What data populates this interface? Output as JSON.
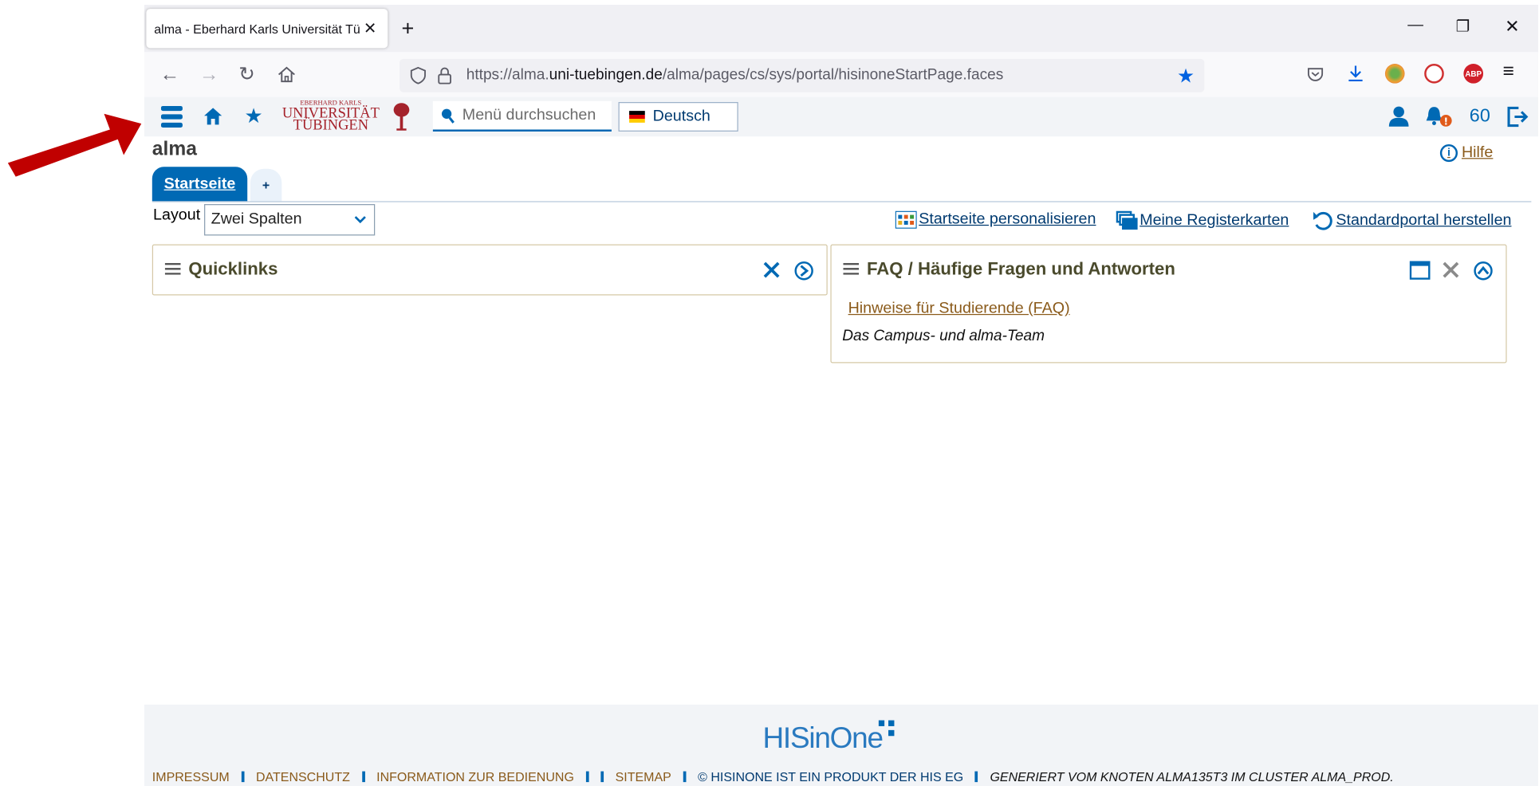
{
  "browser": {
    "tab_title": "alma - Eberhard Karls Universität Tü",
    "tab_close": "✕",
    "new_tab": "+",
    "url_prefix": "https://alma.",
    "url_domain": "uni-tuebingen.de",
    "url_path": "/alma/pages/cs/sys/portal/hisinoneStartPage.faces"
  },
  "header": {
    "search_placeholder": "Menü durchsuchen",
    "language": "Deutsch",
    "session_timer": "60",
    "logo_line1": "EBERHARD KARLS",
    "logo_line2": "UNIVERSITÄT",
    "logo_line3": "TÜBINGEN"
  },
  "page": {
    "title": "alma",
    "help_label": "Hilfe",
    "tabs": [
      {
        "label": "Startseite"
      }
    ],
    "add_tab": "+",
    "layout_label": "Layout",
    "layout_value": "Zwei Spalten",
    "actions": {
      "personalize": "Startseite personalisieren",
      "registers": "Meine Registerkarten",
      "restore": "Standardportal herstellen"
    }
  },
  "panels": {
    "quicklinks": {
      "title": "Quicklinks"
    },
    "faq": {
      "title": "FAQ / Häufige Fragen und Antworten",
      "link": "Hinweise für Studierende (FAQ)",
      "signature": "Das Campus- und alma-Team"
    }
  },
  "footer": {
    "logo": "HISinOne",
    "links": [
      "IMPRESSUM",
      "DATENSCHUTZ",
      "INFORMATION ZUR BEDIENUNG",
      "SITEMAP"
    ],
    "copyright": "© HISINONE IST EIN PRODUKT DER HIS EG",
    "generated": "GENERIERT VOM KNOTEN ALMA135T3 IM CLUSTER ALMA_PROD."
  },
  "colors": {
    "brand_blue": "#0069b4",
    "link_brown": "#8a5a1a",
    "arrow_red": "#c00000"
  }
}
